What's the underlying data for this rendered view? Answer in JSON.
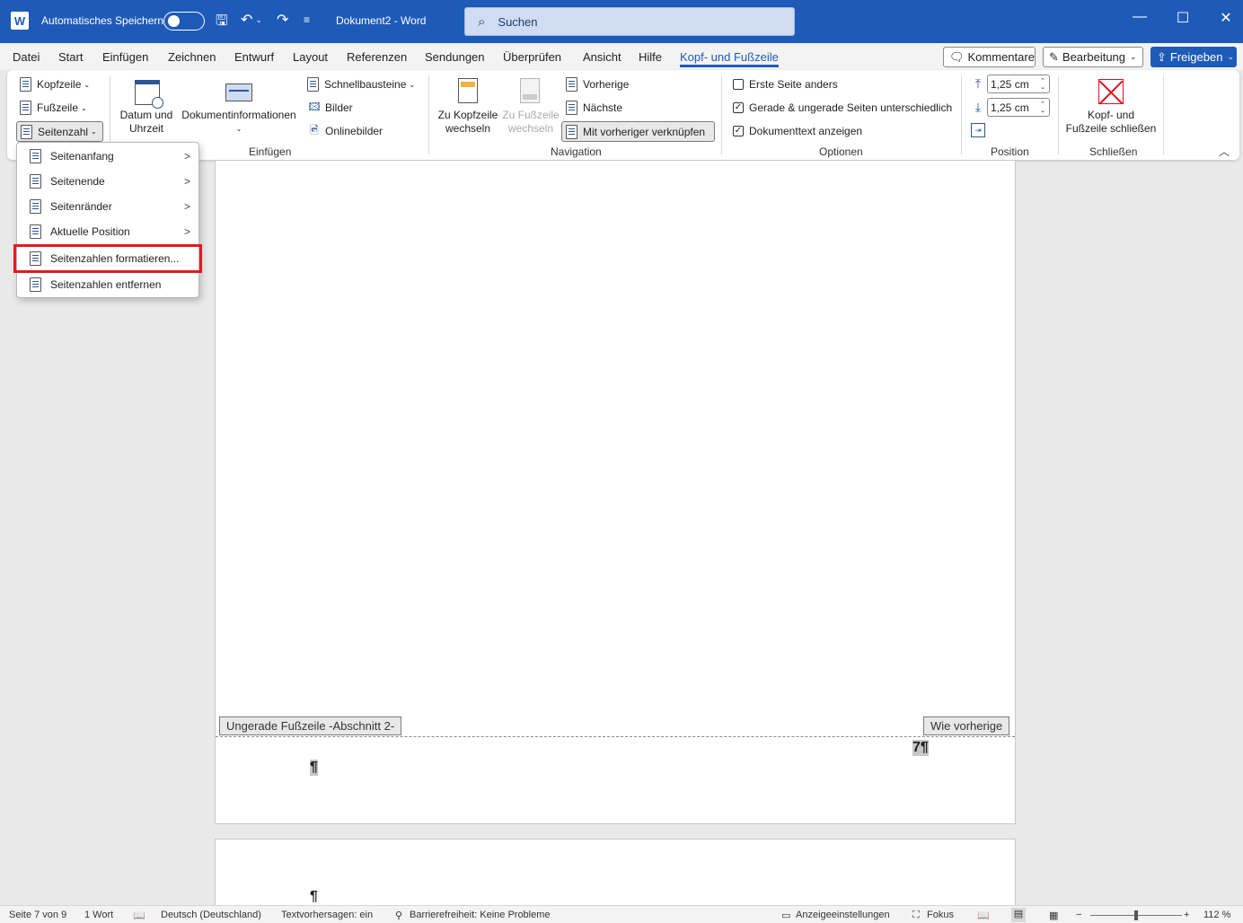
{
  "titlebar": {
    "autosave_label": "Automatisches Speichern",
    "doc_title": "Dokument2  -  Word",
    "search_placeholder": "Suchen",
    "word_letter": "W"
  },
  "tabs": [
    "Datei",
    "Start",
    "Einfügen",
    "Zeichnen",
    "Entwurf",
    "Layout",
    "Referenzen",
    "Sendungen",
    "Überprüfen",
    "Ansicht",
    "Hilfe",
    "Kopf- und Fußzeile"
  ],
  "tab_buttons": {
    "comments": "Kommentare",
    "editing": "Bearbeitung",
    "share": "Freigeben"
  },
  "ribbon": {
    "header": "Kopfzeile",
    "footer": "Fußzeile",
    "page_number": "Seitenzahl",
    "date_time": [
      "Datum und",
      "Uhrzeit"
    ],
    "doc_info": "Dokumentinformationen",
    "quick_parts": "Schnellbausteine",
    "pictures": "Bilder",
    "online_pictures": "Onlinebilder",
    "group_insert": "Einfügen",
    "goto_header": [
      "Zu Kopfzeile",
      "wechseln"
    ],
    "goto_footer": [
      "Zu Fußzeile",
      "wechseln"
    ],
    "previous": "Vorherige",
    "next": "Nächste",
    "link_previous": "Mit vorheriger verknüpfen",
    "group_navigation": "Navigation",
    "different_first": "Erste Seite anders",
    "different_odd_even": "Gerade & ungerade Seiten unterschiedlich",
    "show_doc_text": "Dokumenttext anzeigen",
    "group_options": "Optionen",
    "header_pos": "1,25 cm",
    "footer_pos": "1,25 cm",
    "group_position": "Position",
    "close_hf": [
      "Kopf- und",
      "Fußzeile schließen"
    ],
    "group_close": "Schließen"
  },
  "menu": {
    "items": [
      {
        "label": "Seitenanfang",
        "has_submenu": true
      },
      {
        "label": "Seitenende",
        "has_submenu": true
      },
      {
        "label": "Seitenränder",
        "has_submenu": true
      },
      {
        "label": "Aktuelle Position",
        "has_submenu": true
      },
      {
        "label": "Seitenzahlen formatieren...",
        "has_submenu": false,
        "highlighted": true
      },
      {
        "label": "Seitenzahlen entfernen",
        "has_submenu": false
      }
    ]
  },
  "document": {
    "footer_label": "Ungerade Fußzeile -Abschnitt 2-",
    "same_as_previous": "Wie vorherige",
    "page_number_field": "7¶",
    "pilcrow": "¶"
  },
  "statusbar": {
    "page": "Seite 7 von 9",
    "words": "1 Wort",
    "language": "Deutsch (Deutschland)",
    "text_predictions": "Textvorhersagen: ein",
    "accessibility": "Barrierefreiheit: Keine Probleme",
    "display_settings": "Anzeigeeinstellungen",
    "focus": "Fokus",
    "zoom": "112 %"
  },
  "colors": {
    "accent": "#1e5bb8",
    "highlight_red": "#e01b24"
  }
}
